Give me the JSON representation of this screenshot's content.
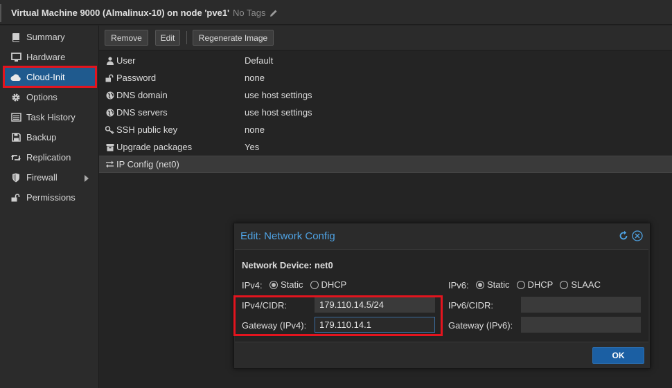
{
  "header": {
    "title": "Virtual Machine 9000 (Almalinux-10) on node 'pve1'",
    "tags": "No Tags"
  },
  "sidebar": {
    "items": [
      {
        "label": "Summary",
        "icon": "book-icon"
      },
      {
        "label": "Hardware",
        "icon": "monitor-icon"
      },
      {
        "label": "Cloud-Init",
        "icon": "cloud-icon",
        "active": true
      },
      {
        "label": "Options",
        "icon": "gear-icon"
      },
      {
        "label": "Task History",
        "icon": "list-icon"
      },
      {
        "label": "Backup",
        "icon": "floppy-icon"
      },
      {
        "label": "Replication",
        "icon": "retweet-icon"
      },
      {
        "label": "Firewall",
        "icon": "shield-icon"
      },
      {
        "label": "Permissions",
        "icon": "unlock-icon"
      }
    ]
  },
  "toolbar": {
    "remove_label": "Remove",
    "edit_label": "Edit",
    "regen_label": "Regenerate Image"
  },
  "cloudinit": {
    "rows": [
      {
        "key": "User",
        "value": "Default",
        "icon": "user-icon"
      },
      {
        "key": "Password",
        "value": "none",
        "icon": "unlock-icon"
      },
      {
        "key": "DNS domain",
        "value": "use host settings",
        "icon": "globe-icon"
      },
      {
        "key": "DNS servers",
        "value": "use host settings",
        "icon": "globe-icon"
      },
      {
        "key": "SSH public key",
        "value": "none",
        "icon": "key-icon"
      },
      {
        "key": "Upgrade packages",
        "value": "Yes",
        "icon": "archive-icon"
      },
      {
        "key": "IP Config (net0)",
        "value": "",
        "icon": "exchange-icon"
      }
    ]
  },
  "dialog": {
    "title": "Edit: Network Config",
    "device_label": "Network Device:",
    "device_value": "net0",
    "ipv4_label": "IPv4:",
    "ipv4_options": [
      "Static",
      "DHCP"
    ],
    "ipv4_selected": "Static",
    "ipv6_label": "IPv6:",
    "ipv6_options": [
      "Static",
      "DHCP",
      "SLAAC"
    ],
    "ipv6_selected": "Static",
    "ipv4_cidr_label": "IPv4/CIDR:",
    "ipv4_cidr_value": "179.110.14.5/24",
    "gateway4_label": "Gateway (IPv4):",
    "gateway4_value": "179.110.14.1",
    "ipv6_cidr_label": "IPv6/CIDR:",
    "ipv6_cidr_value": "",
    "gateway6_label": "Gateway (IPv6):",
    "gateway6_value": "",
    "ok_label": "OK"
  }
}
